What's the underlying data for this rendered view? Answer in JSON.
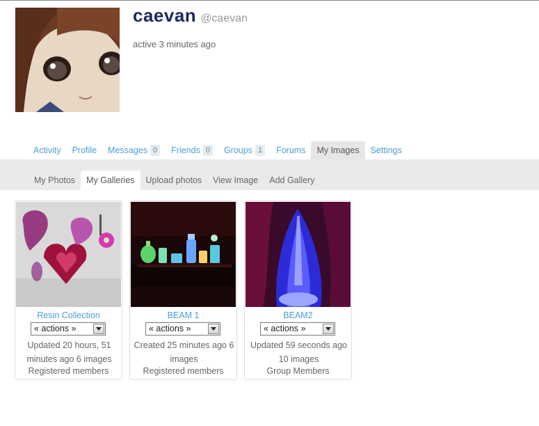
{
  "profile": {
    "display_name": "caevan",
    "handle": "@caevan",
    "activity": "active 3 minutes ago",
    "avatar_icon": "anime-doll-avatar"
  },
  "main_nav": [
    {
      "label": "Activity",
      "count": ""
    },
    {
      "label": "Profile",
      "count": ""
    },
    {
      "label": "Messages",
      "count": "0"
    },
    {
      "label": "Friends",
      "count": "0"
    },
    {
      "label": "Groups",
      "count": "1"
    },
    {
      "label": "Forums",
      "count": ""
    },
    {
      "label": "My Images",
      "count": "",
      "active": true
    },
    {
      "label": "Settings",
      "count": ""
    }
  ],
  "sub_nav": [
    {
      "label": "My Photos"
    },
    {
      "label": "My Galleries",
      "active": true
    },
    {
      "label": "Upload photos"
    },
    {
      "label": "View Image"
    },
    {
      "label": "Add Gallery"
    }
  ],
  "galleries": [
    {
      "title": "Resin Collection",
      "actions_value": "« actions »",
      "meta": "Updated 20 hours, 51 minutes ago 6 images",
      "access": "Registered members",
      "thumb": "pink-resin-hearts"
    },
    {
      "title": "BEAM 1",
      "actions_value": "« actions »",
      "meta": "Created 25 minutes ago 6 images",
      "access": "Registered members",
      "thumb": "glowing-bottles"
    },
    {
      "title": "BEAM2",
      "actions_value": "« actions »",
      "meta": "Updated 59 seconds ago 10 images",
      "access": "Group Members",
      "thumb": "blue-light-sculpture"
    }
  ],
  "colors": {
    "link": "#4a9fd6",
    "name": "#1c2b5a",
    "band": "#eaeaea"
  }
}
